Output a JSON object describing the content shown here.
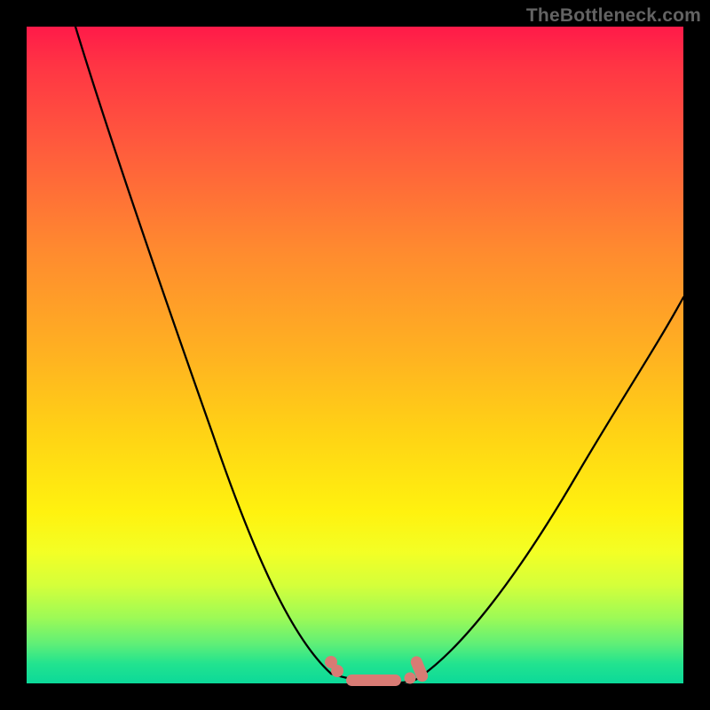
{
  "watermark": "TheBottleneck.com",
  "colors": {
    "frame_background": "#000000",
    "curve_stroke": "#000000",
    "marker_fill": "#d87b74",
    "gradient_top": "#ff1a49",
    "gradient_mid": "#ffd315",
    "gradient_bottom": "#0cd999"
  },
  "chart_data": {
    "type": "line",
    "title": "",
    "xlabel": "",
    "ylabel": "",
    "xlim": [
      0,
      100
    ],
    "ylim": [
      0,
      100
    ],
    "description": "V-shaped bottleneck curve over a red-yellow-green vertical gradient; values estimated from pixel positions within a 740x740 plot area. y = 100 at top (high bottleneck), y = 0 at bottom (no bottleneck).",
    "series": [
      {
        "name": "left-arm",
        "x": [
          7.4,
          12,
          20,
          28,
          36,
          42,
          46.3
        ],
        "y": [
          100,
          86,
          62,
          38,
          15,
          3,
          0.5
        ]
      },
      {
        "name": "valley-floor",
        "x": [
          46.3,
          50,
          54,
          58,
          59.9
        ],
        "y": [
          0.5,
          0,
          0,
          0.2,
          0.8
        ]
      },
      {
        "name": "right-arm",
        "x": [
          59.9,
          66,
          74,
          84,
          94,
          100
        ],
        "y": [
          0.8,
          5,
          15,
          32,
          49,
          59
        ]
      }
    ],
    "markers": [
      {
        "shape": "dot",
        "x": 46.3,
        "y": 3.2
      },
      {
        "shape": "dot",
        "x": 47.3,
        "y": 1.9
      },
      {
        "shape": "bar",
        "x_start": 48.6,
        "x_end": 57.0,
        "y": 0.3
      },
      {
        "shape": "dot",
        "x": 58.4,
        "y": 0.8
      },
      {
        "shape": "bar-tilt",
        "x_start": 58.8,
        "x_end": 60.3,
        "y_start": 1.2,
        "y_end": 3.8
      }
    ]
  }
}
